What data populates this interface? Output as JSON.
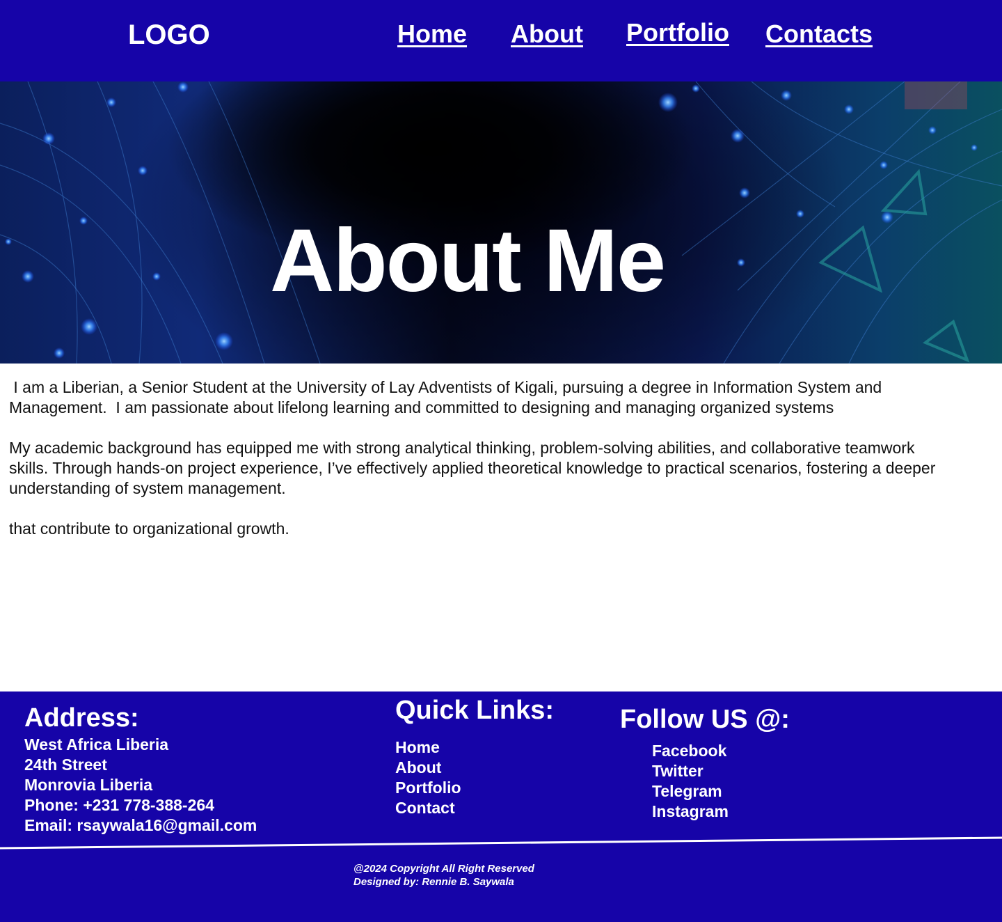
{
  "header": {
    "logo": "LOGO",
    "nav": [
      "Home",
      "About",
      "Portfolio",
      "Contacts"
    ]
  },
  "hero": {
    "title": "About Me"
  },
  "content": {
    "paragraphs": [
      " I am a Liberian, a Senior Student at the University of Lay Adventists of Kigali, pursuing a degree in Information System and Management.  I am passionate about lifelong learning and committed to designing and managing organized systems",
      "My academic background has equipped me with strong analytical thinking, problem-solving abilities, and collaborative teamwork skills. Through hands-on project experience, I’ve effectively applied theoretical knowledge to practical scenarios, fostering a deeper understanding of system management.",
      "that contribute to organizational growth."
    ]
  },
  "footer": {
    "address": {
      "heading": "Address:",
      "lines": [
        "West Africa Liberia",
        "24th Street",
        "Monrovia Liberia",
        "Phone: +231 778-388-264",
        "Email: rsaywala16@gmail.com"
      ]
    },
    "quick_links": {
      "heading": "Quick Links:",
      "items": [
        "Home",
        "About",
        "Portfolio",
        "Contact"
      ]
    },
    "follow": {
      "heading": "Follow US @:",
      "items": [
        "Facebook",
        "Twitter",
        "Telegram",
        "Instagram"
      ]
    },
    "copyright": "@2024 Copyright All Right Reserved",
    "designed_by": "Designed by: Rennie B. Saywala"
  },
  "colors": {
    "brand": "#1604a8",
    "text": "#111111"
  }
}
